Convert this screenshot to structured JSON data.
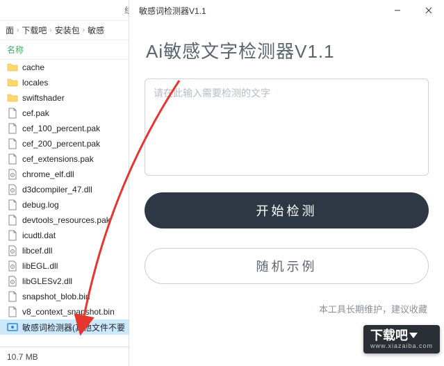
{
  "explorer": {
    "top_label": "组",
    "breadcrumb": [
      "面",
      "下载吧",
      "安装包",
      "敏感"
    ],
    "col_header": "名称",
    "files": [
      {
        "name": "cache",
        "type": "folder"
      },
      {
        "name": "locales",
        "type": "folder"
      },
      {
        "name": "swiftshader",
        "type": "folder"
      },
      {
        "name": "cef.pak",
        "type": "file"
      },
      {
        "name": "cef_100_percent.pak",
        "type": "file"
      },
      {
        "name": "cef_200_percent.pak",
        "type": "file"
      },
      {
        "name": "cef_extensions.pak",
        "type": "file"
      },
      {
        "name": "chrome_elf.dll",
        "type": "dll"
      },
      {
        "name": "d3dcompiler_47.dll",
        "type": "dll"
      },
      {
        "name": "debug.log",
        "type": "file"
      },
      {
        "name": "devtools_resources.pak",
        "type": "file"
      },
      {
        "name": "icudtl.dat",
        "type": "file"
      },
      {
        "name": "libcef.dll",
        "type": "dll"
      },
      {
        "name": "libEGL.dll",
        "type": "dll"
      },
      {
        "name": "libGLESv2.dll",
        "type": "dll"
      },
      {
        "name": "snapshot_blob.bin",
        "type": "file"
      },
      {
        "name": "v8_context_snapshot.bin",
        "type": "file"
      },
      {
        "name": "敏感词检测器(其他文件不要",
        "type": "app",
        "selected": true
      }
    ],
    "status": "10.7 MB"
  },
  "app": {
    "window_title": "敏感词检测器V1.1",
    "heading": "Ai敏感文字检测器V1.1",
    "placeholder": "请在此输入需要检测的文字",
    "btn_detect": "开始检测",
    "btn_sample": "随机示例",
    "footer": "本工具长期维护，建议收藏"
  },
  "watermark": {
    "main": "下载吧",
    "sub": "www.xiazaiba.com"
  }
}
